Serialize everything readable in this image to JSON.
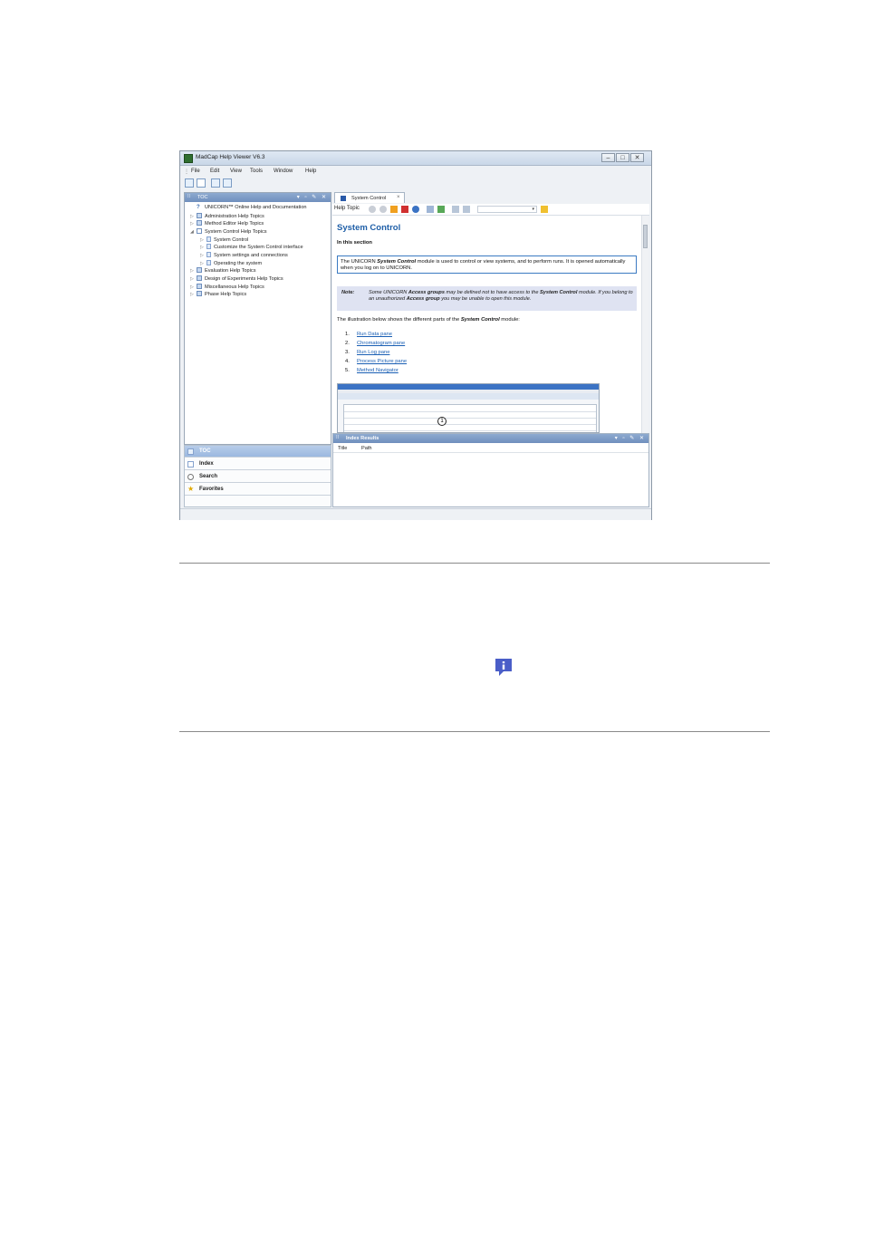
{
  "window": {
    "title": "MadCap Help Viewer V6.3",
    "controls": {
      "minimize": "–",
      "maximize": "□",
      "close": "✕"
    }
  },
  "menu": [
    "File",
    "Edit",
    "View",
    "Tools",
    "Window",
    "Help"
  ],
  "toc_panel": {
    "header": "TOC",
    "items": [
      {
        "label": "UNICORN™ Online Help and Documentation",
        "level": 0,
        "icon": "help-icon"
      },
      {
        "label": "Administration Help Topics",
        "level": 0,
        "icon": "book-icon"
      },
      {
        "label": "Method Editor Help Topics",
        "level": 0,
        "icon": "book-icon"
      },
      {
        "label": "System Control Help Topics",
        "level": 0,
        "icon": "book-open-icon"
      },
      {
        "label": "System Control",
        "level": 1,
        "icon": "page-icon"
      },
      {
        "label": "Customize the System Control interface",
        "level": 1,
        "icon": "page-icon"
      },
      {
        "label": "System settings and connections",
        "level": 1,
        "icon": "page-icon"
      },
      {
        "label": "Operating the system",
        "level": 1,
        "icon": "page-icon"
      },
      {
        "label": "Evaluation Help Topics",
        "level": 0,
        "icon": "book-icon"
      },
      {
        "label": "Design of Experiments Help Topics",
        "level": 0,
        "icon": "book-icon"
      },
      {
        "label": "Miscellaneous Help Topics",
        "level": 0,
        "icon": "book-icon"
      },
      {
        "label": "Phase Help Topics",
        "level": 0,
        "icon": "book-icon"
      }
    ]
  },
  "nav_tabs": [
    "TOC",
    "Index",
    "Search",
    "Favorites"
  ],
  "doc_tab": {
    "label": "System Control",
    "close": "×"
  },
  "help_toolbar": {
    "label": "Help Topic"
  },
  "content": {
    "title": "System Control",
    "subtitle": "In this section",
    "box_text_pre": "The UNICORN ",
    "box_text_bold": "System Control",
    "box_text_post": " module is used to control or view systems, and to perform runs. It is opened automatically when you log on to UNICORN.",
    "note_label": "Note:",
    "note_text_1": "Some UNICORN ",
    "note_bold_1": "Access groups",
    "note_text_2": " may be defined not to have access to the ",
    "note_bold_2": "System Control",
    "note_text_3": " module. If you belong to an unauthorized ",
    "note_bold_3": "Access group",
    "note_text_4": " you may be unable to open this module.",
    "intro_pre": "The illustration below shows the different parts of the ",
    "intro_bold": "System Control",
    "intro_post": " module:",
    "links": [
      {
        "num": "1.",
        "label": "Run Data pane"
      },
      {
        "num": "2.",
        "label": "Chromatogram pane"
      },
      {
        "num": "3.",
        "label": "Run Log pane"
      },
      {
        "num": "4.",
        "label": "Process Picture pane"
      },
      {
        "num": "5.",
        "label": "Method Navigator"
      }
    ],
    "callout": "1"
  },
  "results_panel": {
    "header": "Index Results",
    "columns": [
      "Title",
      "Path"
    ]
  },
  "colors": {
    "accent": "#1f5fa8",
    "link": "#1a5fb4",
    "panel_header": "#7b98c4",
    "note_bg": "#dfe3f2",
    "note_icon": "#4a5ec8"
  }
}
